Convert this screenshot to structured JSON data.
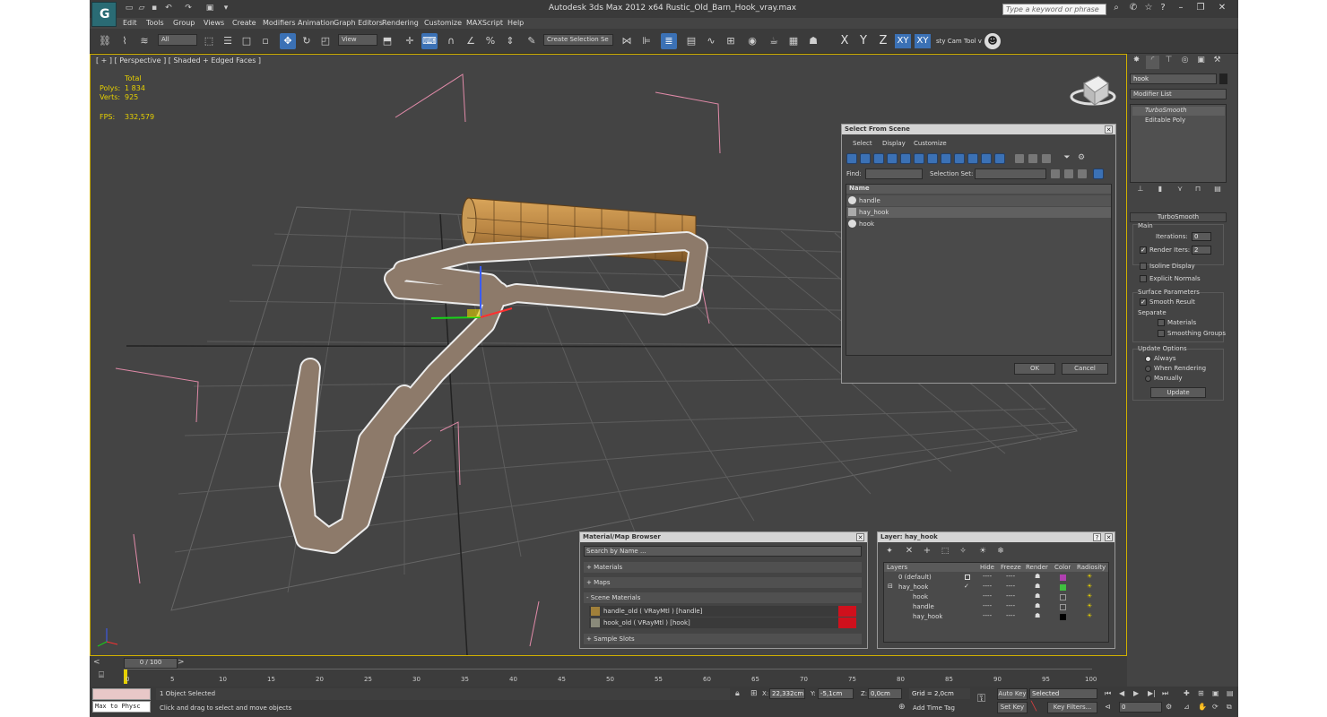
{
  "app": {
    "title": "Autodesk 3ds Max  2012 x64      Rustic_Old_Barn_Hook_vray.max",
    "search_placeholder": "Type a keyword or phrase",
    "logo": "G"
  },
  "menus": [
    "Edit",
    "Tools",
    "Group",
    "Views",
    "Create",
    "Modifiers",
    "Animation",
    "Graph Editors",
    "Rendering",
    "Customize",
    "MAXScript",
    "Help"
  ],
  "toolbar": {
    "filter": "All",
    "view": "View",
    "selection_set": "Create Selection Se",
    "axes": [
      "X",
      "Y",
      "Z",
      "XY",
      "XY"
    ],
    "cam_tool": "sty Cam Tool v"
  },
  "viewport": {
    "label": "[ + ] [ Perspective ] [ Shaded + Edged Faces ]",
    "stats": {
      "total": "Total",
      "polys_label": "Polys:",
      "polys": "1 834",
      "verts_label": "Verts:",
      "verts": "925",
      "fps_label": "FPS:",
      "fps": "332,579"
    }
  },
  "panel": {
    "object_name": "hook",
    "modifier_list": "Modifier List",
    "stack": [
      "TurboSmooth",
      "Editable Poly"
    ],
    "turbosmooth": {
      "title": "TurboSmooth",
      "main": "Main",
      "iterations_label": "Iterations:",
      "iterations": "0",
      "render_iters_label": "Render Iters:",
      "render_iters": "2",
      "isoline": "Isoline Display",
      "explicit": "Explicit Normals",
      "surface": "Surface Parameters",
      "smooth_result": "Smooth Result",
      "separate": "Separate",
      "materials": "Materials",
      "smoothing_groups": "Smoothing Groups",
      "update_options": "Update Options",
      "always": "Always",
      "when_rendering": "When Rendering",
      "manually": "Manually",
      "update": "Update"
    }
  },
  "select_dialog": {
    "title": "Select From Scene",
    "menus": [
      "Select",
      "Display",
      "Customize"
    ],
    "find_label": "Find:",
    "selset_label": "Selection Set:",
    "col_name": "Name",
    "items": [
      "handle",
      "hay_hook",
      "hook"
    ],
    "ok": "OK",
    "cancel": "Cancel"
  },
  "material_browser": {
    "title": "Material/Map Browser",
    "search": "Search by Name ...",
    "sections": [
      "+ Materials",
      "+ Maps",
      "- Scene Materials",
      "+ Sample Slots"
    ],
    "materials": [
      "handle_old  ( VRayMtl )  [handle]",
      "hook_old  ( VRayMtl )  [hook]"
    ]
  },
  "layer_dialog": {
    "title": "Layer: hay_hook",
    "cols": [
      "Layers",
      "Hide",
      "Freeze",
      "Render",
      "Color",
      "Radiosity"
    ],
    "rows": [
      {
        "name": "0 (default)",
        "color": "#b040b0"
      },
      {
        "name": "hay_hook",
        "color": "#40c040"
      },
      {
        "name": "hook",
        "color": "#444444"
      },
      {
        "name": "handle",
        "color": "#444444"
      },
      {
        "name": "hay_hook",
        "color": "#000000"
      }
    ]
  },
  "timeline": {
    "frame": "0 / 100",
    "ticks": [
      "0",
      "5",
      "10",
      "15",
      "20",
      "25",
      "30",
      "35",
      "40",
      "45",
      "50",
      "55",
      "60",
      "65",
      "70",
      "75",
      "80",
      "85",
      "90",
      "95",
      "100"
    ]
  },
  "status": {
    "maxscript": "Max to Physc",
    "selected": "1 Object Selected",
    "prompt": "Click and drag to select and move objects",
    "x_label": "X:",
    "x": "22,332cm",
    "y_label": "Y:",
    "y": "-5,1cm",
    "z_label": "Z:",
    "z": "0,0cm",
    "grid": "Grid = 2,0cm",
    "add_time_tag": "Add Time Tag",
    "auto_key": "Auto Key",
    "selected_dd": "Selected",
    "set_key": "Set Key",
    "key_filters": "Key Filters...",
    "frame_field": "0"
  }
}
